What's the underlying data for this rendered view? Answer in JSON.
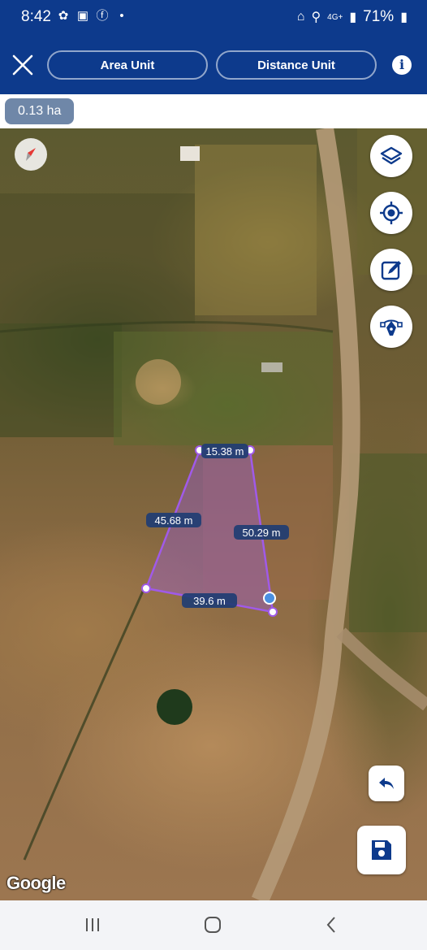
{
  "status_bar": {
    "time": "8:42",
    "network": "4G+",
    "battery": "71%"
  },
  "toolbar": {
    "area_unit_label": "Area Unit",
    "distance_unit_label": "Distance Unit",
    "info_label": "i"
  },
  "area_display": {
    "value": "0.13 ha"
  },
  "measurements": {
    "top": "15.38 m",
    "left": "45.68 m",
    "right": "50.29 m",
    "bottom": "39.6 m"
  },
  "map": {
    "attribution": "Google",
    "polygon_color": "#a05ae8"
  },
  "colors": {
    "header": "#0d3a8c",
    "chip": "#6f87a8",
    "icon_blue": "#0d3a8c"
  }
}
